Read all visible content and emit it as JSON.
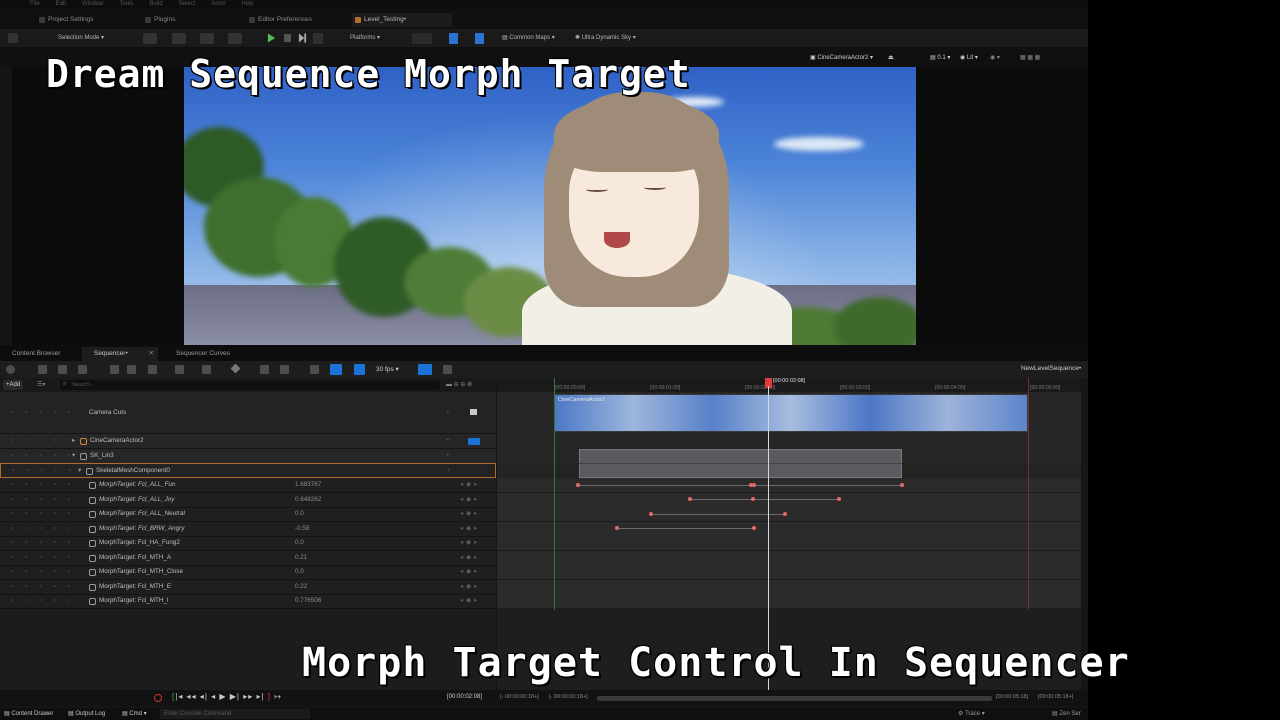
{
  "menu": [
    "File",
    "Edit",
    "Window",
    "Tools",
    "Build",
    "Select",
    "Actor",
    "Help"
  ],
  "editor_tabs": [
    "Project Settings",
    "Plugins",
    "Editor Preferences",
    "Level_Testing•"
  ],
  "toolbar": {
    "selection_mode": "Selection Mode",
    "platforms": "Platforms",
    "common_maps": "Common Maps",
    "ultra_sky": "Ultra Dynamic Sky"
  },
  "viewport_bar": {
    "camera": "CineCameraActor2",
    "lit": "Lit",
    "scale": "0.1"
  },
  "overlay_title_top": "Dream Sequence Morph Target",
  "overlay_title_bottom": "Morph Target Control In Sequencer",
  "panel_tabs": [
    "Content Browser",
    "Sequencer•",
    "Sequencer Curves"
  ],
  "sequencer": {
    "fps": "30 fps",
    "sequence_name": "NewLevelSequence•",
    "add_label": "+Add",
    "search_placeholder": "Search...",
    "current_time": "[00:00:02:08]",
    "time_display": "[00:00:02:08]",
    "ticks": [
      "[00:00:00:00]",
      "[00:00:01:00]",
      "[00:00:02:00]",
      "[00:00:03:00]",
      "[00:00:04:00]",
      "[00:00:05:00]"
    ],
    "start_range": "[- 00:00:00:18+]",
    "end_range": "[- 00:00:00:18+]",
    "right_range": "[00:00:05:18]",
    "right_range2": "[00:00:05:18+]",
    "camera_clip_label": "CineCameraActor2"
  },
  "tracks": [
    {
      "label": "Camera Cuts",
      "value": ""
    },
    {
      "label": "CineCameraActor2",
      "value": ""
    },
    {
      "label": "SK_Lin3",
      "value": ""
    },
    {
      "label": "SkeletalMeshComponent0",
      "value": ""
    },
    {
      "label": "MorphTarget: Fcl_ALL_Fun",
      "value": "1.683767"
    },
    {
      "label": "MorphTarget: Fcl_ALL_Joy",
      "value": "0.648262"
    },
    {
      "label": "MorphTarget: Fcl_ALL_Neutral",
      "value": "0.0"
    },
    {
      "label": "MorphTarget: Fcl_BRW_Angry",
      "value": "-0.58"
    },
    {
      "label": "MorphTarget: Fcl_HA_Fung2",
      "value": "0.0"
    },
    {
      "label": "MorphTarget: Fcl_MTH_A",
      "value": "0.21"
    },
    {
      "label": "MorphTarget: Fcl_MTH_Close",
      "value": "0.0"
    },
    {
      "label": "MorphTarget: Fcl_MTH_E",
      "value": "0.22"
    },
    {
      "label": "MorphTarget: Fcl_MTH_I",
      "value": "0.776506"
    }
  ],
  "status": {
    "content_drawer": "Content Drawer",
    "output_log": "Output Log",
    "cmd": "Cmd",
    "console_placeholder": "Enter Console Command",
    "trace": "Trace",
    "zen": "Zen Ser"
  },
  "colors": {
    "accent_blue": "#1a73d8",
    "key_red": "#e06b6b",
    "playhead_red": "#e53b3b"
  }
}
